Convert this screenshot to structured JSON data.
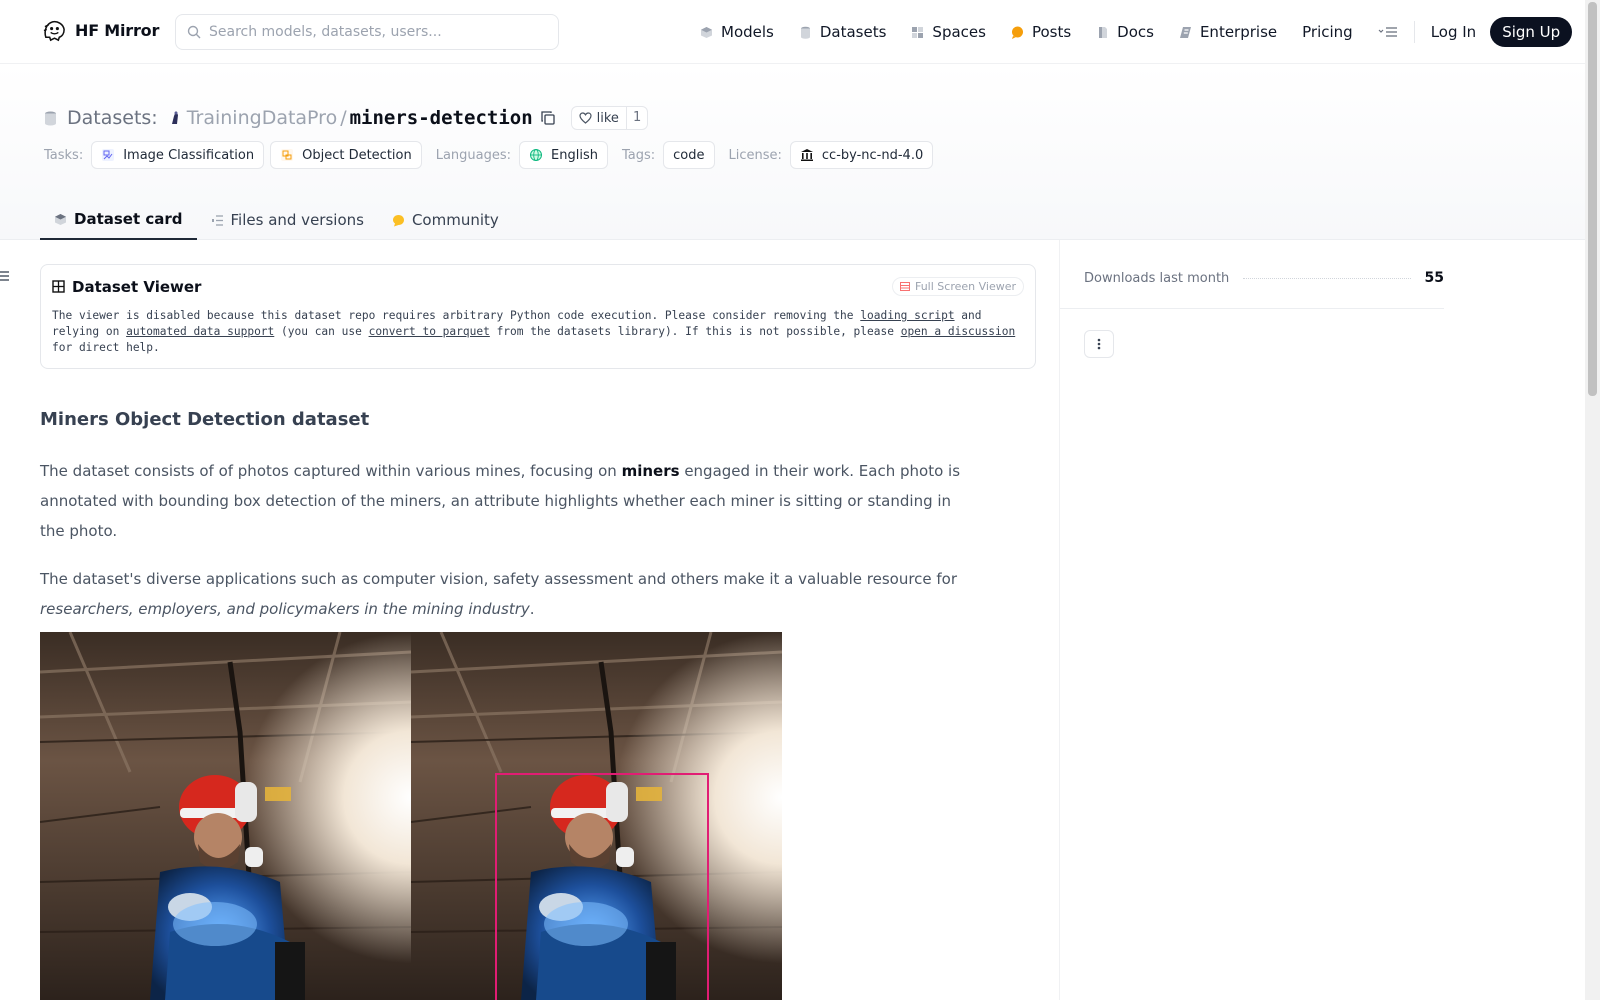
{
  "nav": {
    "brand": "HF Mirror",
    "search_placeholder": "Search models, datasets, users...",
    "links": [
      {
        "label": "Models",
        "icon": "model-cube-icon",
        "color": "#9ca3af"
      },
      {
        "label": "Datasets",
        "icon": "database-icon",
        "color": "#9ca3af"
      },
      {
        "label": "Spaces",
        "icon": "spaces-grid-icon",
        "color": "#9ca3af"
      },
      {
        "label": "Posts",
        "icon": "posts-bubble-icon",
        "color": "#f59e0b"
      },
      {
        "label": "Docs",
        "icon": "docs-icon",
        "color": "#9ca3af"
      },
      {
        "label": "Enterprise",
        "icon": "enterprise-icon",
        "color": "#6b7280"
      },
      {
        "label": "Pricing"
      }
    ],
    "login": "Log In",
    "signup": "Sign Up"
  },
  "header": {
    "crumb_label": "Datasets:",
    "owner": "TrainingDataPro",
    "separator": "/",
    "repo": "miners-detection",
    "like_label": "like",
    "like_count": "1",
    "tags": {
      "tasks_label": "Tasks:",
      "tasks": [
        "Image Classification",
        "Object Detection"
      ],
      "languages_label": "Languages:",
      "languages": [
        "English"
      ],
      "tags_label": "Tags:",
      "tags": [
        "code"
      ],
      "license_label": "License:",
      "license": "cc-by-nc-nd-4.0"
    },
    "tabs": [
      {
        "label": "Dataset card",
        "icon": "dataset-card-icon"
      },
      {
        "label": "Files and versions",
        "icon": "files-icon"
      },
      {
        "label": "Community",
        "icon": "community-icon"
      }
    ]
  },
  "viewer": {
    "title": "Dataset Viewer",
    "full_screen": "Full Screen Viewer",
    "msg_1": "The viewer is disabled because this dataset repo requires arbitrary Python code execution. Please consider removing the ",
    "link_1": "loading script",
    "msg_2": " and relying on ",
    "link_2": "automated data support",
    "msg_3": " (you can use ",
    "link_3": "convert to parquet",
    "msg_4": " from the datasets library). If this is not possible, please ",
    "link_4": "open a discussion",
    "msg_5": " for direct help."
  },
  "card": {
    "title": "Miners Object Detection dataset",
    "p1_a": "The dataset consists of of photos captured within various mines, focusing on ",
    "p1_bold": "miners",
    "p1_b": " engaged in their work. Each photo is annotated with bounding box detection of the miners, an attribute highlights whether each miner is sitting or standing in the photo.",
    "p2_a": "The dataset's diverse applications such as computer vision, safety assessment and others make it a valuable resource for ",
    "p2_italic": "researchers, employers, and policymakers in the mining industry",
    "p2_b": "."
  },
  "sidebar": {
    "downloads_label": "Downloads last month",
    "downloads_count": "55"
  },
  "colors": {
    "accent_dark": "#0b1120",
    "bbox": "#e11d74"
  }
}
